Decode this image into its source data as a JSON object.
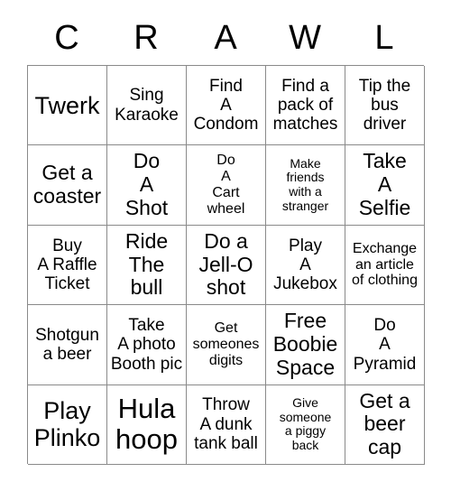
{
  "card": {
    "header_letters": [
      "C",
      "R",
      "A",
      "W",
      "L"
    ],
    "rows": [
      [
        {
          "text": "Twerk",
          "size": "lg"
        },
        {
          "text": "Sing\nKaraoke",
          "size": "sm"
        },
        {
          "text": "Find\nA\nCondom",
          "size": "sm"
        },
        {
          "text": "Find a\npack of\nmatches",
          "size": "sm"
        },
        {
          "text": "Tip the\nbus\ndriver",
          "size": "sm"
        }
      ],
      [
        {
          "text": "Get a\ncoaster",
          "size": "md"
        },
        {
          "text": "Do\nA\nShot",
          "size": "md"
        },
        {
          "text": "Do\nA\nCart\nwheel",
          "size": "xs"
        },
        {
          "text": "Make\nfriends\nwith a\nstranger",
          "size": "xxs"
        },
        {
          "text": "Take\nA\nSelfie",
          "size": "md"
        }
      ],
      [
        {
          "text": "Buy\nA Raffle\nTicket",
          "size": "sm"
        },
        {
          "text": "Ride\nThe\nbull",
          "size": "md"
        },
        {
          "text": "Do a\nJell-O\nshot",
          "size": "md"
        },
        {
          "text": "Play\nA\nJukebox",
          "size": "sm"
        },
        {
          "text": "Exchange\nan article\nof clothing",
          "size": "xs"
        }
      ],
      [
        {
          "text": "Shotgun\na beer",
          "size": "sm"
        },
        {
          "text": "Take\nA photo\nBooth pic",
          "size": "sm"
        },
        {
          "text": "Get\nsomeones\ndigits",
          "size": "xs"
        },
        {
          "text": "Free\nBoobie\nSpace",
          "size": "md"
        },
        {
          "text": "Do\nA\nPyramid",
          "size": "sm"
        }
      ],
      [
        {
          "text": "Play\nPlinko",
          "size": "lg"
        },
        {
          "text": "Hula\nhoop",
          "size": "xl"
        },
        {
          "text": "Throw\nA dunk\ntank ball",
          "size": "sm"
        },
        {
          "text": "Give\nsomeone\na piggy\nback",
          "size": "xxs"
        },
        {
          "text": "Get a\nbeer\ncap",
          "size": "md"
        }
      ]
    ]
  },
  "colors": {
    "border": "#8a8a8a",
    "text": "#000000",
    "background": "#ffffff"
  }
}
